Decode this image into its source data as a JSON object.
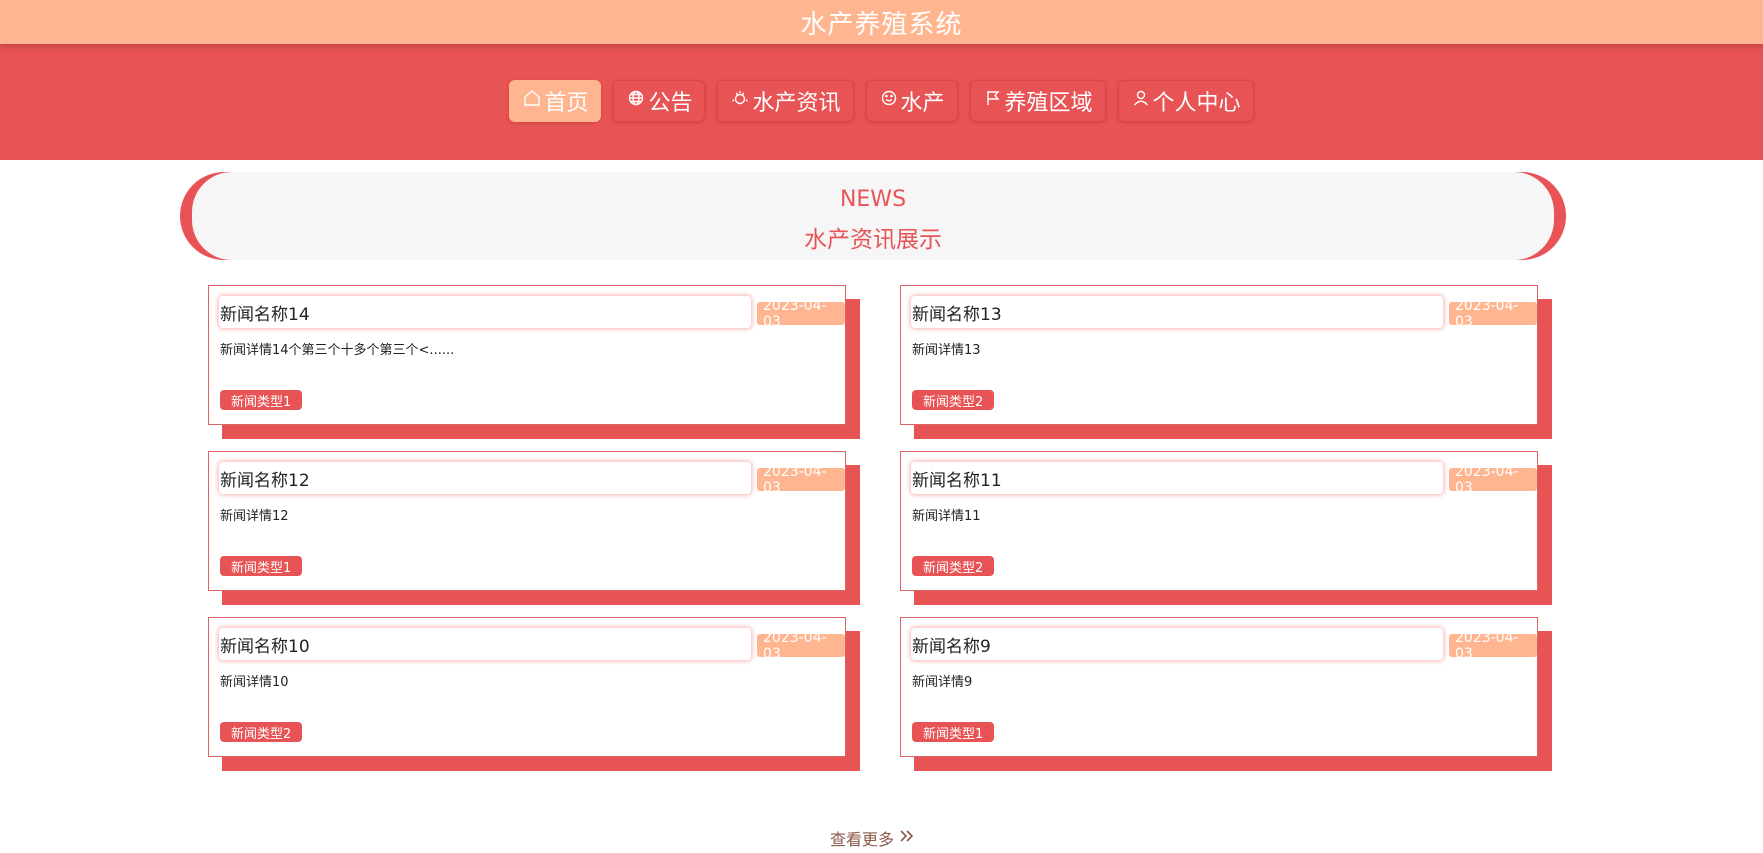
{
  "app": {
    "title": "水产养殖系统"
  },
  "nav": {
    "items": [
      {
        "label": "首页",
        "icon": "home-icon",
        "active": true
      },
      {
        "label": "公告",
        "icon": "globe-icon",
        "active": false
      },
      {
        "label": "水产资讯",
        "icon": "news-icon",
        "active": false
      },
      {
        "label": "水产",
        "icon": "smile-icon",
        "active": false
      },
      {
        "label": "养殖区域",
        "icon": "flag-icon",
        "active": false
      },
      {
        "label": "个人中心",
        "icon": "user-icon",
        "active": false
      }
    ]
  },
  "section": {
    "title_en": "NEWS",
    "title_cn": "水产资讯展示"
  },
  "news": [
    {
      "name": "新闻名称14",
      "date": "2023-04-03",
      "detail": "新闻详情14个第三个十多个第三个<......",
      "type": "新闻类型1"
    },
    {
      "name": "新闻名称13",
      "date": "2023-04-03",
      "detail": "新闻详情13",
      "type": "新闻类型2"
    },
    {
      "name": "新闻名称12",
      "date": "2023-04-03",
      "detail": "新闻详情12",
      "type": "新闻类型1"
    },
    {
      "name": "新闻名称11",
      "date": "2023-04-03",
      "detail": "新闻详情11",
      "type": "新闻类型2"
    },
    {
      "name": "新闻名称10",
      "date": "2023-04-03",
      "detail": "新闻详情10",
      "type": "新闻类型2"
    },
    {
      "name": "新闻名称9",
      "date": "2023-04-03",
      "detail": "新闻详情9",
      "type": "新闻类型1"
    }
  ],
  "more": {
    "label": "查看更多",
    "icon": "double-chevron-right-icon"
  },
  "colors": {
    "accent": "#e85456",
    "peach": "#ffb690",
    "banner_bg": "#f6f6f6"
  }
}
